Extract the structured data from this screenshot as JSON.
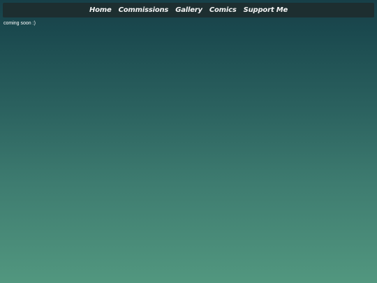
{
  "nav": {
    "items": [
      {
        "label": "Home"
      },
      {
        "label": "Commissions"
      },
      {
        "label": "Gallery"
      },
      {
        "label": "Comics"
      },
      {
        "label": "Support Me"
      }
    ]
  },
  "main": {
    "message": "coming soon :)"
  },
  "colors": {
    "navbar_background": "#1d2e30",
    "gradient_top": "#173f48",
    "gradient_bottom": "#52977f",
    "nav_text": "#f3f3f3"
  }
}
